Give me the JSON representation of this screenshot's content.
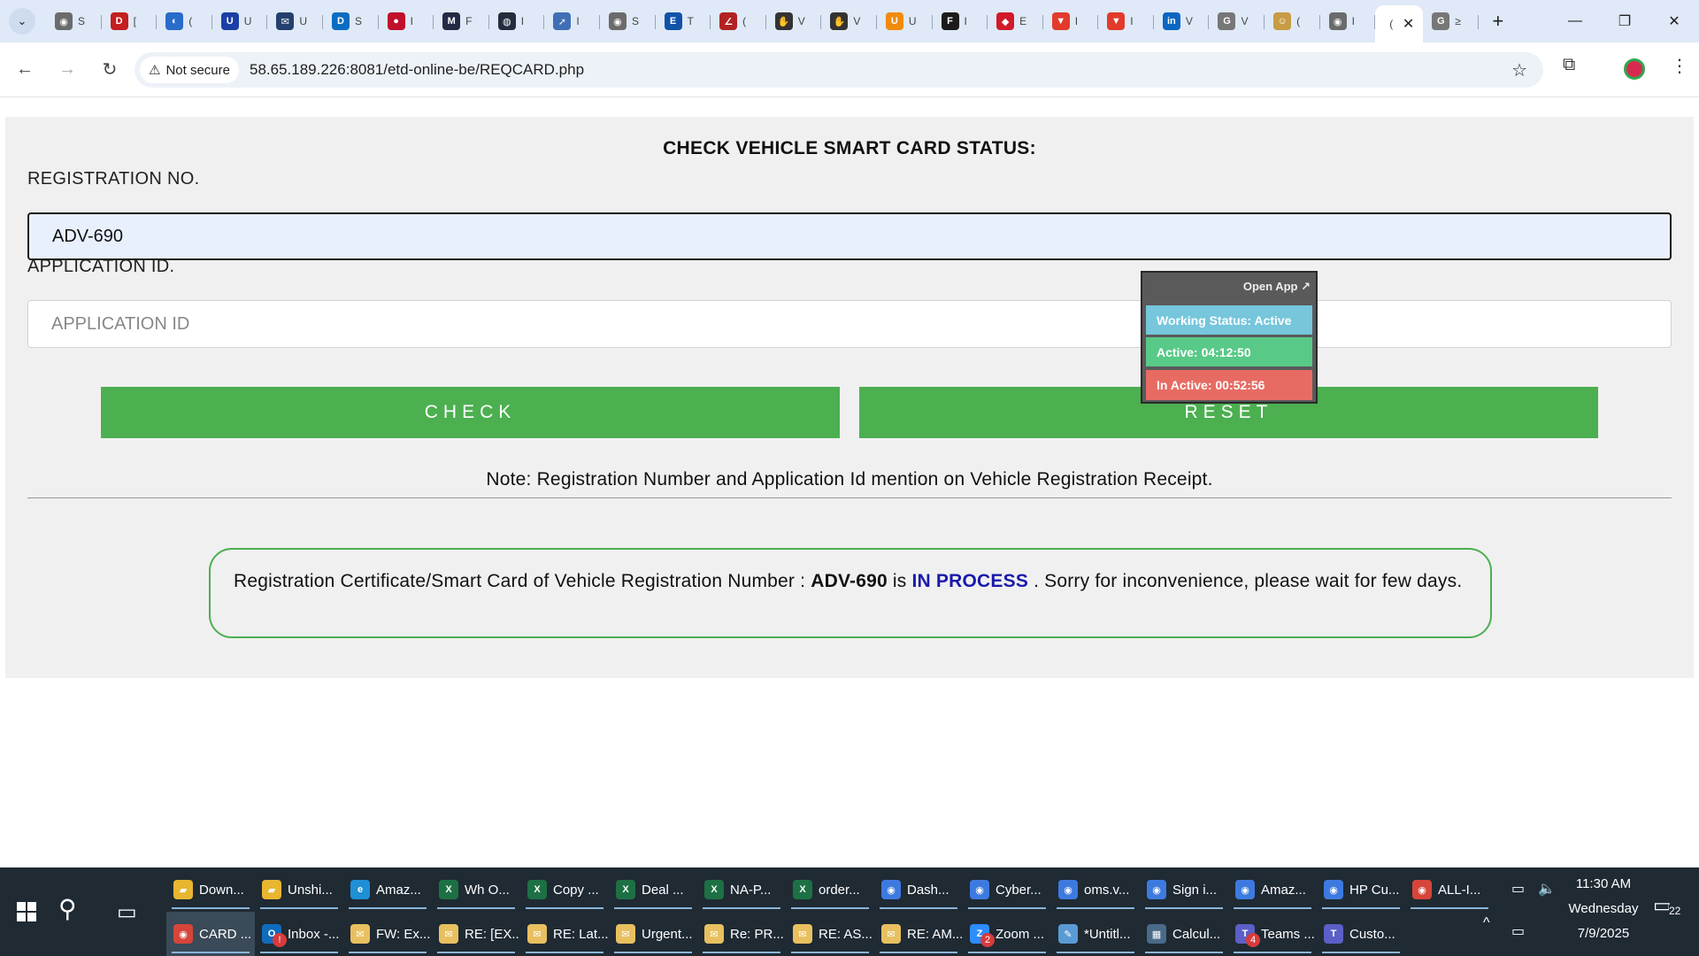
{
  "browser": {
    "tabs": [
      {
        "icon": "chrome-icon",
        "color": "#6b6b6b",
        "glyph": "◉",
        "frag": "S"
      },
      {
        "icon": "dawn-icon",
        "color": "#c41e1e",
        "glyph": "D",
        "frag": "["
      },
      {
        "icon": "edge-icon",
        "color": "#2a6cc9",
        "glyph": "◐",
        "frag": "("
      },
      {
        "icon": "u-icon",
        "color": "#1b3fa6",
        "glyph": "U",
        "frag": "U"
      },
      {
        "icon": "mail-icon",
        "color": "#24406e",
        "glyph": "✉",
        "frag": "U"
      },
      {
        "icon": "dell-icon",
        "color": "#0a6dc2",
        "glyph": "D",
        "frag": "S"
      },
      {
        "icon": "circle-icon",
        "color": "#c0102b",
        "glyph": "●",
        "frag": "I"
      },
      {
        "icon": "m-icon",
        "color": "#222a44",
        "glyph": "M",
        "frag": "F"
      },
      {
        "icon": "shield-icon",
        "color": "#232d3e",
        "glyph": "◍",
        "frag": "I"
      },
      {
        "icon": "compass-icon",
        "color": "#3f6fb6",
        "glyph": "➚",
        "frag": "I"
      },
      {
        "icon": "chrome-icon",
        "color": "#6b6b6b",
        "glyph": "◉",
        "frag": "S"
      },
      {
        "icon": "etn-icon",
        "color": "#1052a8",
        "glyph": "E",
        "frag": "T"
      },
      {
        "icon": "sign-icon",
        "color": "#b22222",
        "glyph": "∠",
        "frag": "("
      },
      {
        "icon": "hand-icon",
        "color": "#333333",
        "glyph": "✋",
        "frag": "V"
      },
      {
        "icon": "hand-icon",
        "color": "#333333",
        "glyph": "✋",
        "frag": "V"
      },
      {
        "icon": "ulta-icon",
        "color": "#f28a0c",
        "glyph": "U",
        "frag": "U"
      },
      {
        "icon": "fluke-icon",
        "color": "#1b1b1b",
        "glyph": "F",
        "frag": "I"
      },
      {
        "icon": "box-icon",
        "color": "#d11a2a",
        "glyph": "◆",
        "frag": "E"
      },
      {
        "icon": "brave-icon",
        "color": "#e23b2b",
        "glyph": "▼",
        "frag": "I"
      },
      {
        "icon": "brave-icon",
        "color": "#e23b2b",
        "glyph": "▼",
        "frag": "I"
      },
      {
        "icon": "linkedin-icon",
        "color": "#0a66c2",
        "glyph": "in",
        "frag": "V"
      },
      {
        "icon": "google-icon",
        "color": "#777777",
        "glyph": "G",
        "frag": "V"
      },
      {
        "icon": "avatar-icon",
        "color": "#c89b45",
        "glyph": "☺",
        "frag": "("
      },
      {
        "icon": "chrome-icon",
        "color": "#6b6b6b",
        "glyph": "◉",
        "frag": "I"
      }
    ],
    "active_tab_frag": "(",
    "after_tab": {
      "icon": "google-icon",
      "color": "#777777",
      "glyph": "G",
      "frag": "≥"
    },
    "security_label": "Not secure",
    "url": "58.65.189.226:8081/etd-online-be/REQCARD.php"
  },
  "page": {
    "title": "CHECK VEHICLE SMART CARD STATUS:",
    "registration_label": "REGISTRATION NO.",
    "registration_value": "ADV-690",
    "application_label": "APPLICATION ID.",
    "application_placeholder": "APPLICATION ID",
    "check_label": "CHECK",
    "reset_label": "RESET",
    "note": "Note: Registration Number and Application Id mention on Vehicle Registration Receipt.",
    "result": {
      "prefix": "Registration Certificate/Smart Card of Vehicle Registration Number : ",
      "reg_no": "ADV-690",
      "is_text": " is ",
      "status": "IN PROCESS",
      "suffix": " . Sorry for inconvenience, please wait for few days."
    }
  },
  "widget": {
    "open_app": "Open App ↗",
    "working_status": "Working Status: Active",
    "active": "Active: 04:12:50",
    "inactive": "In Active: 00:52:56"
  },
  "taskbar": {
    "row1": [
      {
        "icon": "folder-icon",
        "color": "#e8b630",
        "glyph": "▰",
        "label": "Down..."
      },
      {
        "icon": "folder-icon",
        "color": "#e8b630",
        "glyph": "▰",
        "label": "Unshi..."
      },
      {
        "icon": "edge-icon",
        "color": "#1f8fd6",
        "glyph": "e",
        "label": "Amaz..."
      },
      {
        "icon": "excel-icon",
        "color": "#1d7044",
        "glyph": "X",
        "label": "Wh O..."
      },
      {
        "icon": "excel-icon",
        "color": "#1d7044",
        "glyph": "X",
        "label": "Copy ..."
      },
      {
        "icon": "excel-icon",
        "color": "#1d7044",
        "glyph": "X",
        "label": "Deal ..."
      },
      {
        "icon": "excel-icon",
        "color": "#1d7044",
        "glyph": "X",
        "label": "NA-P..."
      },
      {
        "icon": "excel-icon",
        "color": "#1d7044",
        "glyph": "X",
        "label": "order..."
      },
      {
        "icon": "chrome-icon",
        "color": "#3d7ae0",
        "glyph": "◉",
        "label": "Dash..."
      },
      {
        "icon": "chrome-icon",
        "color": "#3d7ae0",
        "glyph": "◉",
        "label": "Cyber..."
      },
      {
        "icon": "chrome-icon",
        "color": "#3d7ae0",
        "glyph": "◉",
        "label": "oms.v..."
      },
      {
        "icon": "chrome-icon",
        "color": "#3d7ae0",
        "glyph": "◉",
        "label": "Sign i..."
      },
      {
        "icon": "chrome-icon",
        "color": "#3d7ae0",
        "glyph": "◉",
        "label": "Amaz..."
      },
      {
        "icon": "chrome-icon",
        "color": "#3d7ae0",
        "glyph": "◉",
        "label": "HP Cu..."
      },
      {
        "icon": "chrome-icon",
        "color": "#d6453a",
        "glyph": "◉",
        "label": "ALL-I..."
      }
    ],
    "row2": [
      {
        "icon": "chrome-icon",
        "color": "#d6453a",
        "glyph": "◉",
        "label": "CARD ...",
        "active": true
      },
      {
        "icon": "outlook-icon",
        "color": "#0f6cbd",
        "glyph": "O",
        "label": "Inbox -...",
        "badge": "!"
      },
      {
        "icon": "mail-icon",
        "color": "#e8c060",
        "glyph": "✉",
        "label": "FW: Ex..."
      },
      {
        "icon": "mail-icon",
        "color": "#e8c060",
        "glyph": "✉",
        "label": "RE: [EX..."
      },
      {
        "icon": "mail-icon",
        "color": "#e8c060",
        "glyph": "✉",
        "label": "RE: Lat..."
      },
      {
        "icon": "mail-icon",
        "color": "#e8c060",
        "glyph": "✉",
        "label": "Urgent..."
      },
      {
        "icon": "mail-icon",
        "color": "#e8c060",
        "glyph": "✉",
        "label": "Re: PR..."
      },
      {
        "icon": "mail-icon",
        "color": "#e8c060",
        "glyph": "✉",
        "label": "RE: AS..."
      },
      {
        "icon": "mail-icon",
        "color": "#e8c060",
        "glyph": "✉",
        "label": "RE: AM..."
      },
      {
        "icon": "zoom-icon",
        "color": "#2d8cff",
        "glyph": "Z",
        "label": "Zoom ...",
        "badge": "2"
      },
      {
        "icon": "notepad-icon",
        "color": "#5a9bd5",
        "glyph": "✎",
        "label": "*Untitl..."
      },
      {
        "icon": "calculator-icon",
        "color": "#4a6a88",
        "glyph": "▦",
        "label": "Calcul..."
      },
      {
        "icon": "teams-icon",
        "color": "#5b5fc7",
        "glyph": "T",
        "label": "Teams ...",
        "badge": "4"
      },
      {
        "icon": "teams-icon",
        "color": "#5b5fc7",
        "glyph": "T",
        "label": "Custo..."
      }
    ],
    "time": "11:30 AM",
    "day": "Wednesday",
    "date": "7/9/2025",
    "notifications": "22"
  }
}
